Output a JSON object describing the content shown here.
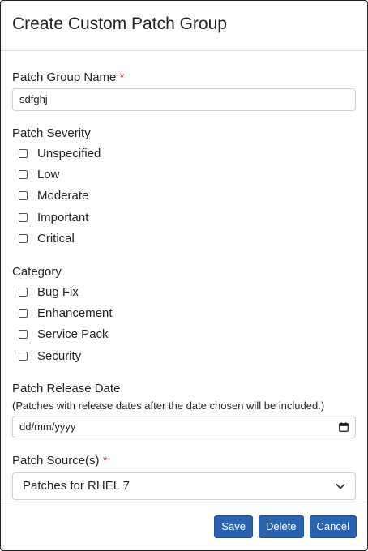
{
  "modal": {
    "title": "Create Custom Patch Group"
  },
  "group_name": {
    "label": "Patch Group Name",
    "required_mark": "*",
    "value": "sdfghj"
  },
  "severity": {
    "label": "Patch Severity",
    "options": [
      "Unspecified",
      "Low",
      "Moderate",
      "Important",
      "Critical"
    ]
  },
  "category": {
    "label": "Category",
    "options": [
      "Bug Fix",
      "Enhancement",
      "Service Pack",
      "Security"
    ]
  },
  "release_date": {
    "label": "Patch Release Date",
    "hint": "(Patches with release dates after the date chosen will be included.)",
    "placeholder": "dd/mm/yyyy"
  },
  "source": {
    "label": "Patch Source(s)",
    "required_mark": "*",
    "selected": "Patches for RHEL 7"
  },
  "footer": {
    "save_label": "Save",
    "delete_label": "Delete",
    "cancel_label": "Cancel"
  }
}
